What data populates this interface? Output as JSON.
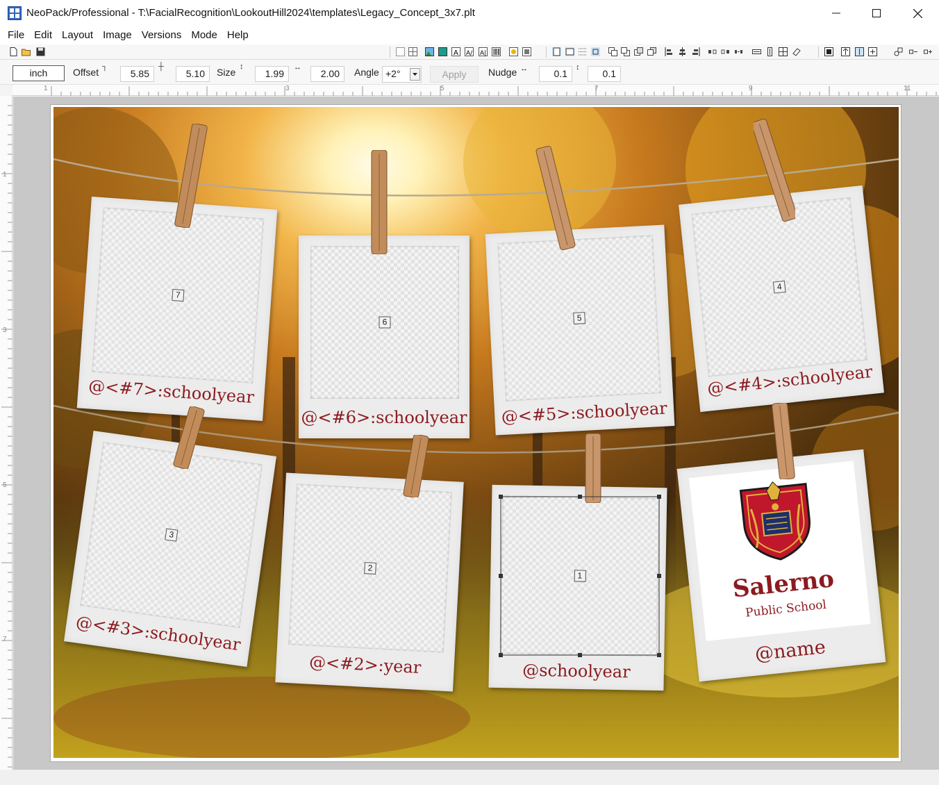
{
  "window": {
    "title": "NeoPack/Professional - T:\\FacialRecognition\\LookoutHill2024\\templates\\Legacy_Concept_3x7.plt",
    "controls": [
      "minimize-icon",
      "maximize-icon",
      "close-icon"
    ]
  },
  "menu": {
    "items": [
      "File",
      "Edit",
      "Layout",
      "Image",
      "Versions",
      "Mode",
      "Help"
    ]
  },
  "toolbar": {
    "file_icons": [
      "new-file-icon",
      "open-folder-icon",
      "save-icon"
    ]
  },
  "propbar": {
    "unit": "inch",
    "offset_label": "Offset",
    "offset_x": "5.85",
    "offset_y": "5.10",
    "size_label": "Size",
    "size_w": "1.99",
    "size_h": "2.00",
    "angle_label": "Angle",
    "angle_value": "+2°",
    "apply_label": "Apply",
    "nudge_label": "Nudge",
    "nudge_x": "0.1",
    "nudge_y": "0.1"
  },
  "ruler": {
    "top_labels": [
      "1",
      "3",
      "5",
      "7",
      "9",
      "11"
    ],
    "left_labels": [
      "1",
      "3",
      "5",
      "7"
    ]
  },
  "canvas": {
    "slots": [
      {
        "number": "7",
        "caption": "@<#7>:schoolyear"
      },
      {
        "number": "6",
        "caption": "@<#6>:schoolyear"
      },
      {
        "number": "5",
        "caption": "@<#5>:schoolyear"
      },
      {
        "number": "4",
        "caption": "@<#4>:schoolyear"
      },
      {
        "number": "3",
        "caption": "@<#3>:schoolyear"
      },
      {
        "number": "2",
        "caption": "@<#2>:year"
      },
      {
        "number": "1",
        "caption": "@schoolyear"
      }
    ],
    "logo_card": {
      "school_name": "Salerno",
      "school_sub": "Public School",
      "caption": "@name"
    }
  },
  "colors": {
    "caption_red": "#8c1a1f",
    "crest_red": "#c0172c",
    "crest_gold": "#e0b23a"
  }
}
